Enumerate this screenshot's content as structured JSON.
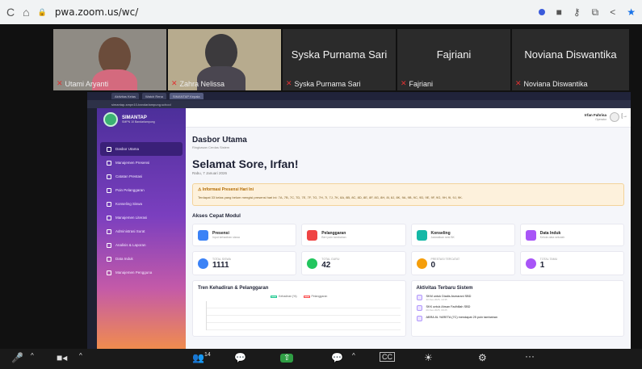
{
  "browser": {
    "url": "pwa.zoom.us/wc/",
    "back_icon": "back-icon",
    "home_icon": "home-icon"
  },
  "gallery": {
    "tiles": [
      {
        "name": "Utami Aryanti",
        "big": ""
      },
      {
        "name": "Zahra Nelissa",
        "big": ""
      },
      {
        "name": "Syska Purnama Sari",
        "big": "Syska Purnama Sari"
      },
      {
        "name": "Fajriani",
        "big": "Fajriani"
      },
      {
        "name": "Noviana Diswantika",
        "big": "Noviana Diswantika"
      }
    ]
  },
  "shared": {
    "tabs": [
      "Aktivitas Kelas",
      "Watch Rena",
      "SIMANTAP Kepala"
    ],
    "address": "simantap-smpn10-bandarlampung.school",
    "app": {
      "brand": "SIMANTAP",
      "brand_sub": "SMPN 10 Bandarlampung",
      "menu": [
        "Dasbor Utama",
        "Manajemen Presensi",
        "Catatan Prestasi",
        "Poin Pelanggaran",
        "Konseling Siswa",
        "Manajemen Literasi",
        "Administrasi Surat",
        "Analisis & Laporan",
        "Data Induk",
        "Manajemen Pengguna"
      ],
      "user": {
        "name": "Irfan Fahrisa",
        "role": "Operator"
      },
      "title": "Dasbor Utama",
      "subtitle": "Ringkasan Cerdas Sistem",
      "greeting": "Selamat Sore, Irfan!",
      "date": "Rabu, 7 Januari 2026",
      "alert": {
        "title": "Informasi Presensi Hari Ini",
        "text": "Terdapat 33 kelas yang belum mengisi presensi hari ini: 7A, 7B, 7C, 7D, 7E, 7F, 7G, 7H, 7I, 7J, 7K, 8A, 8B, 8C, 8D, 8E, 8F, 8G, 8H, 8I, 8J, 8K, 9A, 9B, 9C, 9D, 9E, 9F, 9G, 9H, 9I, 9J, 9K."
      },
      "quick_title": "Akses Cepat Modul",
      "quick": [
        {
          "title": "Presensi",
          "desc": "Input kehadiran siswa",
          "color": "#3b82f6"
        },
        {
          "title": "Pelanggaran",
          "desc": "Beri poin tambahan",
          "color": "#ef4444"
        },
        {
          "title": "Konseling",
          "desc": "Jadwalkan sesi BK",
          "color": "#14b8a6"
        },
        {
          "title": "Data Induk",
          "desc": "Kelola data sekolah",
          "color": "#a855f7"
        }
      ],
      "stats": [
        {
          "label": "TOTAL SISWA",
          "value": "1111",
          "color": "#3b82f6"
        },
        {
          "label": "TOTAL GURU",
          "value": "42",
          "color": "#22c55e"
        },
        {
          "label": "PRESTASI TERCATAT",
          "value": "0",
          "color": "#f59e0b"
        },
        {
          "label": "TOTAL TAMU",
          "value": "1",
          "color": "#a855f7"
        }
      ],
      "trend": {
        "title": "Tren Kehadiran & Pelanggaran",
        "legend_a": "Kehadiran (%)",
        "legend_b": "Pelanggaran"
      },
      "activity": {
        "title": "Aktivitas Terbaru Sistem",
        "items": [
          {
            "t": "SKM untuk Diadis Asmarani SBD",
            "d": "30 Des 2025, 10:35"
          },
          {
            "t": "SKK untuk Ahsan Fadhillah SBD",
            "d": "09 Des 2025, 09:25"
          },
          {
            "t": "ABRA 8L YARETA (7C) mendapat 25 poin tambahan",
            "d": ""
          }
        ]
      }
    }
  },
  "dock": {
    "participants_count": "14"
  }
}
